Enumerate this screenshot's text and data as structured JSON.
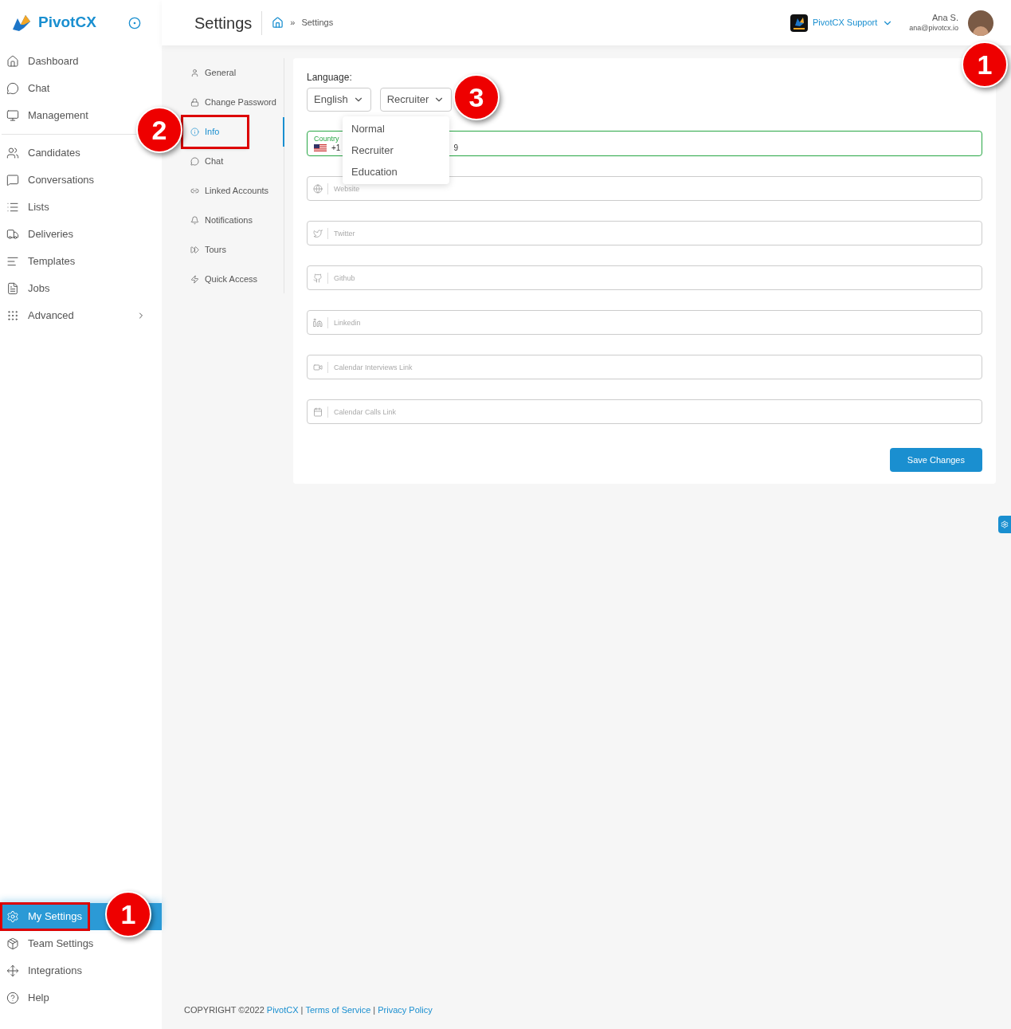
{
  "brand": {
    "name": "PivotCX"
  },
  "sidebar": {
    "top_items": [
      {
        "label": "Dashboard"
      },
      {
        "label": "Chat"
      },
      {
        "label": "Management"
      }
    ],
    "items": [
      {
        "label": "Candidates",
        "expandable": false
      },
      {
        "label": "Conversations",
        "expandable": false
      },
      {
        "label": "Lists",
        "expandable": false
      },
      {
        "label": "Deliveries",
        "expandable": false
      },
      {
        "label": "Templates",
        "expandable": false
      },
      {
        "label": "Jobs",
        "expandable": false
      },
      {
        "label": "Advanced",
        "expandable": true
      }
    ],
    "bottom_items": [
      {
        "label": "My Settings",
        "selected": true
      },
      {
        "label": "Team Settings",
        "selected": false
      },
      {
        "label": "Integrations",
        "selected": false
      },
      {
        "label": "Help",
        "selected": false
      }
    ]
  },
  "header": {
    "title": "Settings",
    "breadcrumb_separator": "»",
    "breadcrumb": "Settings",
    "workspace": "PivotCX Support",
    "user_name": "Ana S.",
    "user_email": "ana@pivotcx.io"
  },
  "settings_menu": [
    {
      "label": "General",
      "selected": false
    },
    {
      "label": "Change Password",
      "selected": false
    },
    {
      "label": "Info",
      "selected": true
    },
    {
      "label": "Chat",
      "selected": false
    },
    {
      "label": "Linked Accounts",
      "selected": false
    },
    {
      "label": "Notifications",
      "selected": false
    },
    {
      "label": "Tours",
      "selected": false
    },
    {
      "label": "Quick Access",
      "selected": false
    }
  ],
  "form": {
    "language_label": "Language:",
    "language": "English",
    "profile_type": "Recruiter",
    "profile_options": [
      {
        "label": "Normal"
      },
      {
        "label": "Recruiter"
      },
      {
        "label": "Education"
      }
    ],
    "phone": {
      "label": "Country",
      "code": "+1",
      "number": "9"
    },
    "fields": [
      {
        "placeholder": "Website"
      },
      {
        "placeholder": "Twitter"
      },
      {
        "placeholder": "Github"
      },
      {
        "placeholder": "Linkedin"
      },
      {
        "placeholder": "Calendar Interviews Link"
      },
      {
        "placeholder": "Calendar Calls Link"
      }
    ],
    "save_button": "Save Changes"
  },
  "footer": {
    "copyright": "COPYRIGHT ©2022",
    "brand_link": "PivotCX",
    "separator": "|",
    "terms": "Terms of Service",
    "privacy": "Privacy Policy"
  },
  "callouts": [
    {
      "number": "1"
    },
    {
      "number": "2"
    },
    {
      "number": "3"
    },
    {
      "number": "1"
    }
  ]
}
